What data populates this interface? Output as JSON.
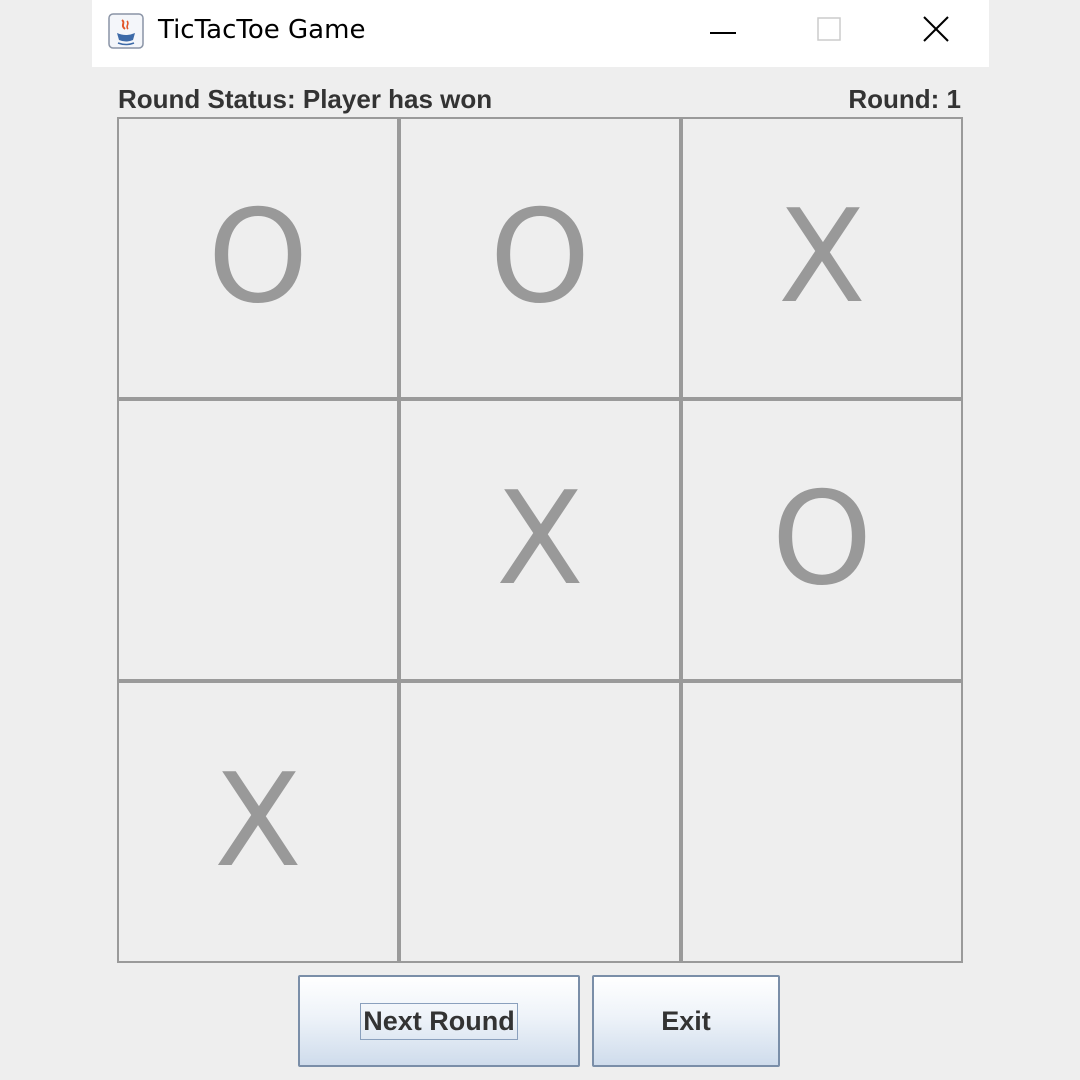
{
  "window": {
    "title": "TicTacToe Game",
    "icon": "java-app-icon"
  },
  "titlebar_controls": {
    "minimize_icon": "minimize-icon",
    "maximize_icon": "maximize-icon",
    "close_icon": "close-icon"
  },
  "status": {
    "round_status": "Round Status: Player has won",
    "round_number": "Round: 1"
  },
  "board": {
    "cells": [
      "O",
      "O",
      "X",
      "",
      "X",
      "O",
      "X",
      "",
      ""
    ]
  },
  "buttons": {
    "next_round": "Next Round",
    "exit": "Exit"
  },
  "colors": {
    "background": "#eeeeee",
    "titlebar": "#ffffff",
    "grid_line": "#9a9a9a",
    "mark": "#999999",
    "text": "#333333"
  }
}
